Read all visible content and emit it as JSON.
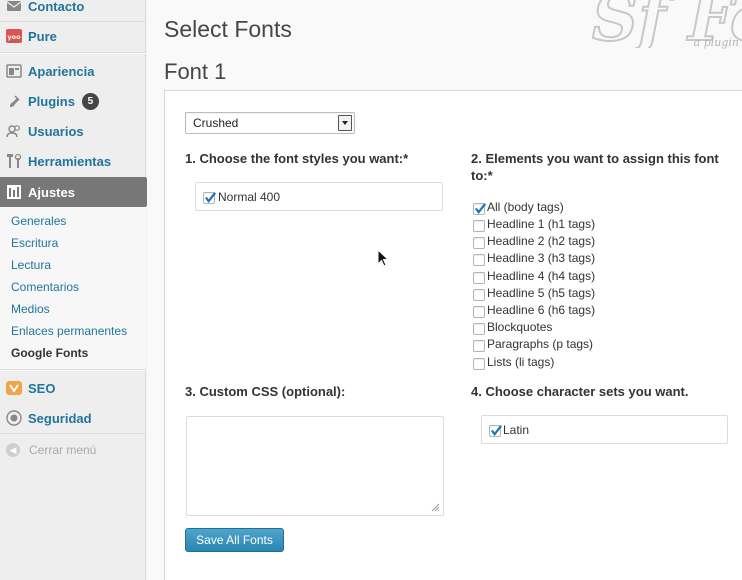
{
  "sidebar": {
    "items": [
      {
        "label": "Contacto",
        "icon": "contact-icon"
      },
      {
        "label": "Pure",
        "icon": "yoo-icon"
      },
      {
        "label": "Apariencia",
        "icon": "appearance-icon"
      },
      {
        "label": "Plugins",
        "icon": "plugin-icon",
        "badge": "5"
      },
      {
        "label": "Usuarios",
        "icon": "users-icon"
      },
      {
        "label": "Herramientas",
        "icon": "tools-icon"
      },
      {
        "label": "Ajustes",
        "icon": "settings-icon"
      }
    ],
    "submenu": [
      "Generales",
      "Escritura",
      "Lectura",
      "Comentarios",
      "Medios",
      "Enlaces permanentes",
      "Google Fonts"
    ],
    "lower_items": [
      {
        "label": "SEO",
        "icon": "seo-icon"
      },
      {
        "label": "Seguridad",
        "icon": "security-icon"
      }
    ],
    "collapse_label": "Cerrar menú"
  },
  "main": {
    "title": "Select Fonts",
    "font_heading": "Font 1",
    "logo_letters": "Sf Fo",
    "logo_tagline": "a plugin",
    "font_select_value": "Crushed",
    "styles_title": "1. Choose the font styles you want:*",
    "styles": [
      {
        "label": "Normal 400",
        "checked": true
      }
    ],
    "elements_title": "2. Elements you want to assign this font to:*",
    "elements": [
      {
        "label": "All (body tags)",
        "checked": true
      },
      {
        "label": "Headline 1 (h1 tags)",
        "checked": false
      },
      {
        "label": "Headline 2 (h2 tags)",
        "checked": false
      },
      {
        "label": "Headline 3 (h3 tags)",
        "checked": false
      },
      {
        "label": "Headline 4 (h4 tags)",
        "checked": false
      },
      {
        "label": "Headline 5 (h5 tags)",
        "checked": false
      },
      {
        "label": "Headline 6 (h6 tags)",
        "checked": false
      },
      {
        "label": "Blockquotes",
        "checked": false
      },
      {
        "label": "Paragraphs (p tags)",
        "checked": false
      },
      {
        "label": "Lists (li tags)",
        "checked": false
      }
    ],
    "css_title": "3. Custom CSS (optional):",
    "css_value": "",
    "charset_title": "4. Choose character sets you want.",
    "charsets": [
      {
        "label": "Latin",
        "checked": true
      }
    ],
    "save_label": "Save All Fonts"
  },
  "colors": {
    "link": "#21759b",
    "active_menu": "#777777",
    "button": "#2a86b3"
  }
}
